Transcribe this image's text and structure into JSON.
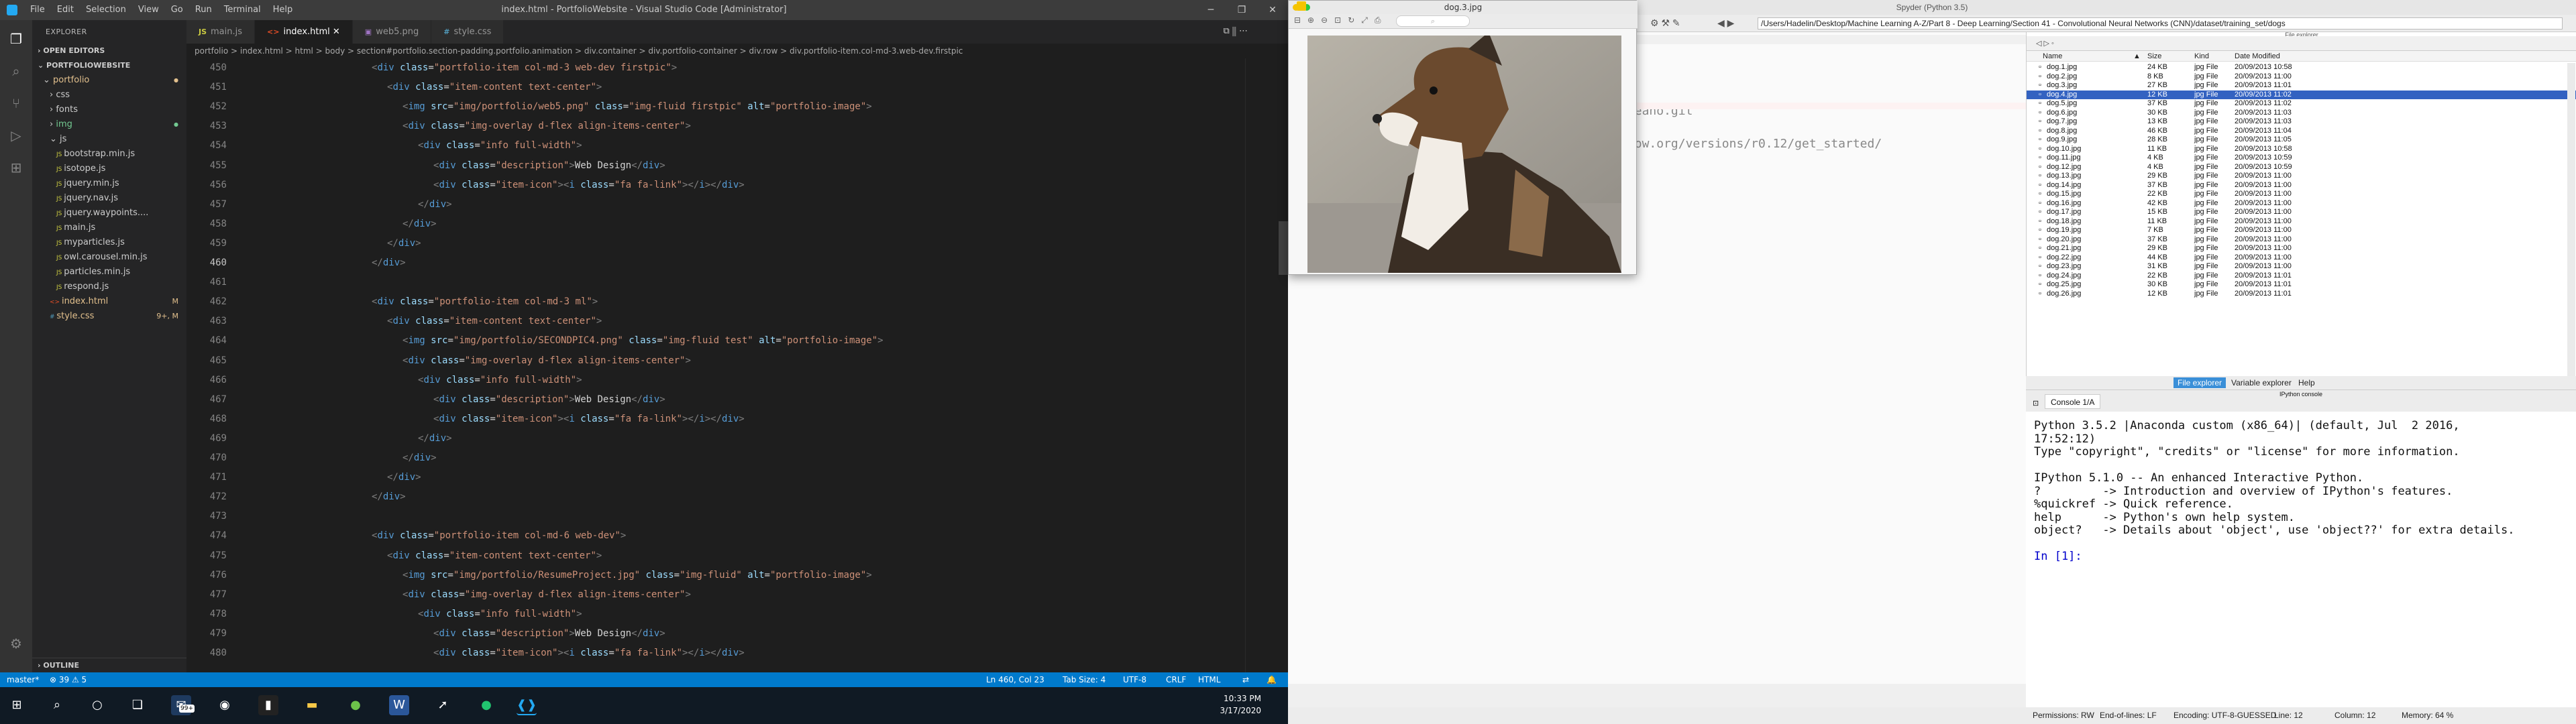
{
  "vscode": {
    "window_title": "index.html - PortfolioWebsite - Visual Studio Code [Administrator]",
    "menu": [
      "File",
      "Edit",
      "Selection",
      "View",
      "Go",
      "Run",
      "Terminal",
      "Help"
    ],
    "sidebar": {
      "header": "EXPLORER",
      "open_editors": "OPEN EDITORS",
      "project": "PORTFOLIOWEBSITE",
      "items": [
        {
          "label": "portfolio",
          "indent": 1,
          "type": "folder-open",
          "badge": "",
          "color": "#e2c08d"
        },
        {
          "label": "css",
          "indent": 2,
          "type": "folder",
          "badge": "",
          "color": "#ccc"
        },
        {
          "label": "fonts",
          "indent": 2,
          "type": "folder",
          "badge": "",
          "color": "#ccc"
        },
        {
          "label": "img",
          "indent": 2,
          "type": "folder",
          "badge": "",
          "color": "#73c991"
        },
        {
          "label": "js",
          "indent": 2,
          "type": "folder-open",
          "badge": "",
          "color": "#ccc"
        },
        {
          "label": "bootstrap.min.js",
          "indent": 3,
          "type": "js",
          "badge": "",
          "color": "#ccc"
        },
        {
          "label": "isotope.js",
          "indent": 3,
          "type": "js",
          "badge": "",
          "color": "#ccc"
        },
        {
          "label": "jquery.min.js",
          "indent": 3,
          "type": "js",
          "badge": "",
          "color": "#ccc"
        },
        {
          "label": "jquery.nav.js",
          "indent": 3,
          "type": "js",
          "badge": "",
          "color": "#ccc"
        },
        {
          "label": "jquery.waypoints....",
          "indent": 3,
          "type": "js",
          "badge": "",
          "color": "#ccc"
        },
        {
          "label": "main.js",
          "indent": 3,
          "type": "js",
          "badge": "",
          "color": "#ccc"
        },
        {
          "label": "myparticles.js",
          "indent": 3,
          "type": "js",
          "badge": "",
          "color": "#ccc"
        },
        {
          "label": "owl.carousel.min.js",
          "indent": 3,
          "type": "js",
          "badge": "",
          "color": "#ccc"
        },
        {
          "label": "particles.min.js",
          "indent": 3,
          "type": "js",
          "badge": "",
          "color": "#ccc"
        },
        {
          "label": "respond.js",
          "indent": 3,
          "type": "js",
          "badge": "",
          "color": "#ccc"
        },
        {
          "label": "index.html",
          "indent": 2,
          "type": "html",
          "badge": "M",
          "color": "#e2c08d"
        },
        {
          "label": "style.css",
          "indent": 2,
          "type": "css",
          "badge": "9+, M",
          "color": "#e2c08d"
        }
      ],
      "outline": "OUTLINE"
    },
    "tabs": [
      {
        "label": "main.js",
        "icon": "JS",
        "color": "#cbcb41",
        "active": false
      },
      {
        "label": "index.html",
        "icon": "<>",
        "color": "#e44d26",
        "active": true
      },
      {
        "label": "web5.png",
        "icon": "▣",
        "color": "#a074c4",
        "active": false
      },
      {
        "label": "style.css",
        "icon": "#",
        "color": "#519aba",
        "active": false
      }
    ],
    "breadcrumb": "portfolio > index.html > html > body > section#portfolio.section-padding.portfolio.animation > div.container > div.portfolio-container > div.row > div.portfolio-item.col-md-3.web-dev.firstpic",
    "code_lines": [
      {
        "n": "450",
        "i": 4,
        "html": "<span class=p>&lt;</span><span class=t>div</span> <span class=a>class</span><span class=x>=</span><span class=s>\"portfolio-item col-md-3 web-dev firstpic\"</span><span class=p>&gt;</span>"
      },
      {
        "n": "451",
        "i": 5,
        "html": "<span class=p>&lt;</span><span class=t>div</span> <span class=a>class</span><span class=x>=</span><span class=s>\"item-content text-center\"</span><span class=p>&gt;</span>"
      },
      {
        "n": "452",
        "i": 6,
        "html": "<span class=p>&lt;</span><span class=t>img</span> <span class=a>src</span><span class=x>=</span><span class=s>\"img/portfolio/web5.png\"</span> <span class=a>class</span><span class=x>=</span><span class=s>\"img-fluid firstpic\"</span> <span class=a>alt</span><span class=x>=</span><span class=s>\"portfolio-image\"</span><span class=p>&gt;</span>"
      },
      {
        "n": "453",
        "i": 6,
        "html": "<span class=p>&lt;</span><span class=t>div</span> <span class=a>class</span><span class=x>=</span><span class=s>\"img-overlay d-flex align-items-center\"</span><span class=p>&gt;</span>"
      },
      {
        "n": "454",
        "i": 7,
        "html": "<span class=p>&lt;</span><span class=t>div</span> <span class=a>class</span><span class=x>=</span><span class=s>\"info full-width\"</span><span class=p>&gt;</span>"
      },
      {
        "n": "455",
        "i": 8,
        "html": "<span class=p>&lt;</span><span class=t>div</span> <span class=a>class</span><span class=x>=</span><span class=s>\"description\"</span><span class=p>&gt;</span><span class=x>Web Design</span><span class=p>&lt;/</span><span class=t>div</span><span class=p>&gt;</span>"
      },
      {
        "n": "456",
        "i": 8,
        "html": "<span class=p>&lt;</span><span class=t>div</span> <span class=a>class</span><span class=x>=</span><span class=s>\"item-icon\"</span><span class=p>&gt;&lt;</span><span class=t>i</span> <span class=a>class</span><span class=x>=</span><span class=s>\"fa fa-link\"</span><span class=p>&gt;&lt;/</span><span class=t>i</span><span class=p>&gt;&lt;/</span><span class=t>div</span><span class=p>&gt;</span>"
      },
      {
        "n": "457",
        "i": 7,
        "html": "<span class=p>&lt;/</span><span class=t>div</span><span class=p>&gt;</span>"
      },
      {
        "n": "458",
        "i": 6,
        "html": "<span class=p>&lt;/</span><span class=t>div</span><span class=p>&gt;</span>"
      },
      {
        "n": "459",
        "i": 5,
        "html": "<span class=p>&lt;/</span><span class=t>div</span><span class=p>&gt;</span>"
      },
      {
        "n": "460",
        "i": 4,
        "html": "<span class=p>&lt;/</span><span class=t>div</span><span class=p>&gt;</span>"
      },
      {
        "n": "461",
        "i": 0,
        "html": ""
      },
      {
        "n": "462",
        "i": 4,
        "html": "<span class=p>&lt;</span><span class=t>div</span> <span class=a>class</span><span class=x>=</span><span class=s>\"portfolio-item col-md-3 ml\"</span><span class=p>&gt;</span>"
      },
      {
        "n": "463",
        "i": 5,
        "html": "<span class=p>&lt;</span><span class=t>div</span> <span class=a>class</span><span class=x>=</span><span class=s>\"item-content text-center\"</span><span class=p>&gt;</span>"
      },
      {
        "n": "464",
        "i": 6,
        "html": "<span class=p>&lt;</span><span class=t>img</span> <span class=a>src</span><span class=x>=</span><span class=s>\"img/portfolio/SECONDPIC4.png\"</span> <span class=a>class</span><span class=x>=</span><span class=s>\"img-fluid test\"</span> <span class=a>alt</span><span class=x>=</span><span class=s>\"portfolio-image\"</span><span class=p>&gt;</span>"
      },
      {
        "n": "465",
        "i": 6,
        "html": "<span class=p>&lt;</span><span class=t>div</span> <span class=a>class</span><span class=x>=</span><span class=s>\"img-overlay d-flex align-items-center\"</span><span class=p>&gt;</span>"
      },
      {
        "n": "466",
        "i": 7,
        "html": "<span class=p>&lt;</span><span class=t>div</span> <span class=a>class</span><span class=x>=</span><span class=s>\"info full-width\"</span><span class=p>&gt;</span>"
      },
      {
        "n": "467",
        "i": 8,
        "html": "<span class=p>&lt;</span><span class=t>div</span> <span class=a>class</span><span class=x>=</span><span class=s>\"description\"</span><span class=p>&gt;</span><span class=x>Web Design</span><span class=p>&lt;/</span><span class=t>div</span><span class=p>&gt;</span>"
      },
      {
        "n": "468",
        "i": 8,
        "html": "<span class=p>&lt;</span><span class=t>div</span> <span class=a>class</span><span class=x>=</span><span class=s>\"item-icon\"</span><span class=p>&gt;&lt;</span><span class=t>i</span> <span class=a>class</span><span class=x>=</span><span class=s>\"fa fa-link\"</span><span class=p>&gt;&lt;/</span><span class=t>i</span><span class=p>&gt;&lt;/</span><span class=t>div</span><span class=p>&gt;</span>"
      },
      {
        "n": "469",
        "i": 7,
        "html": "<span class=p>&lt;/</span><span class=t>div</span><span class=p>&gt;</span>"
      },
      {
        "n": "470",
        "i": 6,
        "html": "<span class=p>&lt;/</span><span class=t>div</span><span class=p>&gt;</span>"
      },
      {
        "n": "471",
        "i": 5,
        "html": "<span class=p>&lt;/</span><span class=t>div</span><span class=p>&gt;</span>"
      },
      {
        "n": "472",
        "i": 4,
        "html": "<span class=p>&lt;/</span><span class=t>div</span><span class=p>&gt;</span>"
      },
      {
        "n": "473",
        "i": 0,
        "html": ""
      },
      {
        "n": "474",
        "i": 4,
        "html": "<span class=p>&lt;</span><span class=t>div</span> <span class=a>class</span><span class=x>=</span><span class=s>\"portfolio-item col-md-6 web-dev\"</span><span class=p>&gt;</span>"
      },
      {
        "n": "475",
        "i": 5,
        "html": "<span class=p>&lt;</span><span class=t>div</span> <span class=a>class</span><span class=x>=</span><span class=s>\"item-content text-center\"</span><span class=p>&gt;</span>"
      },
      {
        "n": "476",
        "i": 6,
        "html": "<span class=p>&lt;</span><span class=t>img</span> <span class=a>src</span><span class=x>=</span><span class=s>\"img/portfolio/ResumeProject.jpg\"</span> <span class=a>class</span><span class=x>=</span><span class=s>\"img-fluid\"</span> <span class=a>alt</span><span class=x>=</span><span class=s>\"portfolio-image\"</span><span class=p>&gt;</span>"
      },
      {
        "n": "477",
        "i": 6,
        "html": "<span class=p>&lt;</span><span class=t>div</span> <span class=a>class</span><span class=x>=</span><span class=s>\"img-overlay d-flex align-items-center\"</span><span class=p>&gt;</span>"
      },
      {
        "n": "478",
        "i": 7,
        "html": "<span class=p>&lt;</span><span class=t>div</span> <span class=a>class</span><span class=x>=</span><span class=s>\"info full-width\"</span><span class=p>&gt;</span>"
      },
      {
        "n": "479",
        "i": 8,
        "html": "<span class=p>&lt;</span><span class=t>div</span> <span class=a>class</span><span class=x>=</span><span class=s>\"description\"</span><span class=p>&gt;</span><span class=x>Web Design</span><span class=p>&lt;/</span><span class=t>div</span><span class=p>&gt;</span>"
      },
      {
        "n": "480",
        "i": 8,
        "html": "<span class=p>&lt;</span><span class=t>div</span> <span class=a>class</span><span class=x>=</span><span class=s>\"item-icon\"</span><span class=p>&gt;&lt;</span><span class=t>i</span> <span class=a>class</span><span class=x>=</span><span class=s>\"fa fa-link\"</span><span class=p>&gt;&lt;/</span><span class=t>i</span><span class=p>&gt;&lt;/</span><span class=t>div</span><span class=p>&gt;</span>"
      }
    ],
    "status": {
      "branch": "master*",
      "problems": "⊗ 39 ⚠ 5",
      "position": "Ln 460, Col 23",
      "tab_size": "Tab Size: 4",
      "encoding": "UTF-8",
      "eol": "CRLF",
      "language": "HTML"
    }
  },
  "taskbar": {
    "time": "10:33 PM",
    "date": "3/17/2020",
    "mail_badge": "99+"
  },
  "image_viewer": {
    "title": "dog.3.jpg"
  },
  "spyder": {
    "title": "Spyder (Python 3.5)",
    "path": "/Users/Hadelin/Desktop/Machine Learning A-Z/Part 8 - Deep Learning/Section 41 - Convolutional Neural Networks (CNN)/dataset/training_set/dogs",
    "editor_fragments": [
      "github.com/Theano/Theano.git",
      "https://www.tensorflow.org/versions/r0.12/get_started/"
    ],
    "file_explorer": {
      "title": "File explorer",
      "columns": [
        "Name",
        "Size",
        "Kind",
        "Date Modified"
      ],
      "files": [
        {
          "name": "dog.1.jpg",
          "size": "24 KB",
          "kind": "jpg File",
          "date": "20/09/2013 10:58"
        },
        {
          "name": "dog.2.jpg",
          "size": "8 KB",
          "kind": "jpg File",
          "date": "20/09/2013 11:00"
        },
        {
          "name": "dog.3.jpg",
          "size": "27 KB",
          "kind": "jpg File",
          "date": "20/09/2013 11:01"
        },
        {
          "name": "dog.4.jpg",
          "size": "12 KB",
          "kind": "jpg File",
          "date": "20/09/2013 11:02",
          "selected": true
        },
        {
          "name": "dog.5.jpg",
          "size": "37 KB",
          "kind": "jpg File",
          "date": "20/09/2013 11:02"
        },
        {
          "name": "dog.6.jpg",
          "size": "30 KB",
          "kind": "jpg File",
          "date": "20/09/2013 11:03"
        },
        {
          "name": "dog.7.jpg",
          "size": "13 KB",
          "kind": "jpg File",
          "date": "20/09/2013 11:03"
        },
        {
          "name": "dog.8.jpg",
          "size": "46 KB",
          "kind": "jpg File",
          "date": "20/09/2013 11:04"
        },
        {
          "name": "dog.9.jpg",
          "size": "28 KB",
          "kind": "jpg File",
          "date": "20/09/2013 11:05"
        },
        {
          "name": "dog.10.jpg",
          "size": "11 KB",
          "kind": "jpg File",
          "date": "20/09/2013 10:58"
        },
        {
          "name": "dog.11.jpg",
          "size": "4 KB",
          "kind": "jpg File",
          "date": "20/09/2013 10:59"
        },
        {
          "name": "dog.12.jpg",
          "size": "4 KB",
          "kind": "jpg File",
          "date": "20/09/2013 10:59"
        },
        {
          "name": "dog.13.jpg",
          "size": "29 KB",
          "kind": "jpg File",
          "date": "20/09/2013 11:00"
        },
        {
          "name": "dog.14.jpg",
          "size": "37 KB",
          "kind": "jpg File",
          "date": "20/09/2013 11:00"
        },
        {
          "name": "dog.15.jpg",
          "size": "22 KB",
          "kind": "jpg File",
          "date": "20/09/2013 11:00"
        },
        {
          "name": "dog.16.jpg",
          "size": "42 KB",
          "kind": "jpg File",
          "date": "20/09/2013 11:00"
        },
        {
          "name": "dog.17.jpg",
          "size": "15 KB",
          "kind": "jpg File",
          "date": "20/09/2013 11:00"
        },
        {
          "name": "dog.18.jpg",
          "size": "11 KB",
          "kind": "jpg File",
          "date": "20/09/2013 11:00"
        },
        {
          "name": "dog.19.jpg",
          "size": "7 KB",
          "kind": "jpg File",
          "date": "20/09/2013 11:00"
        },
        {
          "name": "dog.20.jpg",
          "size": "37 KB",
          "kind": "jpg File",
          "date": "20/09/2013 11:00"
        },
        {
          "name": "dog.21.jpg",
          "size": "29 KB",
          "kind": "jpg File",
          "date": "20/09/2013 11:00"
        },
        {
          "name": "dog.22.jpg",
          "size": "44 KB",
          "kind": "jpg File",
          "date": "20/09/2013 11:00"
        },
        {
          "name": "dog.23.jpg",
          "size": "31 KB",
          "kind": "jpg File",
          "date": "20/09/2013 11:00"
        },
        {
          "name": "dog.24.jpg",
          "size": "22 KB",
          "kind": "jpg File",
          "date": "20/09/2013 11:01"
        },
        {
          "name": "dog.25.jpg",
          "size": "30 KB",
          "kind": "jpg File",
          "date": "20/09/2013 11:01"
        },
        {
          "name": "dog.26.jpg",
          "size": "12 KB",
          "kind": "jpg File",
          "date": "20/09/2013 11:01"
        }
      ],
      "pane_tabs": [
        "File explorer",
        "Variable explorer",
        "Help"
      ]
    },
    "console": {
      "pane_title": "IPython console",
      "tab": "Console 1/A",
      "lines": [
        "Python 3.5.2 |Anaconda custom (x86_64)| (default, Jul  2 2016,",
        "17:52:12)",
        "Type \"copyright\", \"credits\" or \"license\" for more information.",
        "",
        "IPython 5.1.0 -- An enhanced Interactive Python.",
        "?         -> Introduction and overview of IPython's features.",
        "%quickref -> Quick reference.",
        "help      -> Python's own help system.",
        "object?   -> Details about 'object', use 'object??' for extra details.",
        ""
      ],
      "prompt": "In [1]:"
    },
    "status": {
      "permissions": "Permissions: RW",
      "eol": "End-of-lines: LF",
      "encoding": "Encoding: UTF-8-GUESSED",
      "line": "Line: 12",
      "column": "Column: 12",
      "memory": "Memory: 64 %"
    }
  }
}
